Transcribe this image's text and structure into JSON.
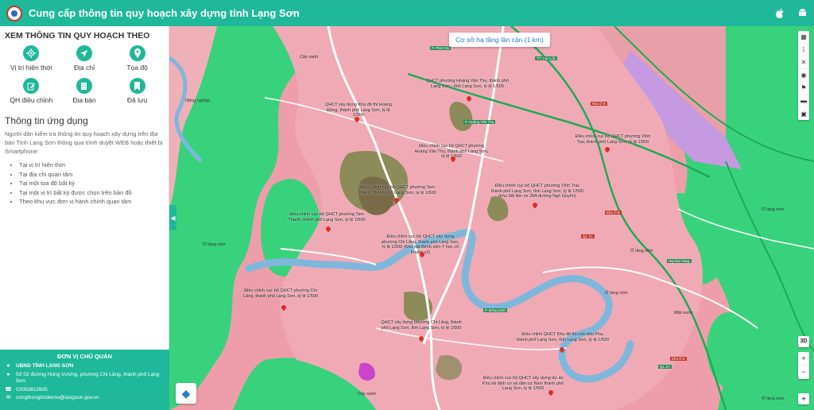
{
  "header": {
    "title": "Cung cấp thông tin quy hoạch xây dựng tỉnh Lạng Sơn",
    "icons": [
      "apple-icon",
      "android-icon"
    ]
  },
  "sidebar": {
    "title": "XEM THÔNG TIN QUY HOẠCH THEO",
    "items": [
      {
        "label": "Vị trí hiện thời",
        "icon": "crosshair-icon"
      },
      {
        "label": "Địa chỉ",
        "icon": "navigation-icon"
      },
      {
        "label": "Tọa độ",
        "icon": "location-pin-icon"
      },
      {
        "label": "QH điều chỉnh",
        "icon": "edit-icon"
      },
      {
        "label": "Địa bàn",
        "icon": "building-icon"
      },
      {
        "label": "Đã lưu",
        "icon": "bookmark-icon"
      }
    ],
    "app_title": "Thông tin ứng dụng",
    "app_desc": "Người dân kiểm tra thông tin quy hoạch xây dựng trên địa bàn Tỉnh Lạng Sơn thông qua trình duyệt WEB hoặc thiết bị Smartphone:",
    "app_list": [
      "Tại vị trí hiện thời",
      "Tại địa chỉ quan tâm",
      "Tại một tọa độ bất kỳ",
      "Tại một vị trí bất kỳ được chọn trên bản đồ",
      "Theo khu vực đơn vị hành chính quan tâm"
    ]
  },
  "footer": {
    "heading": "ĐƠN VỊ CHỦ QUẢN",
    "org": "UBND TỈNH LẠNG SƠN",
    "address": "Số 02 đường Hùng Vương, phường Chi Lăng, thành phố Lạng Sơn",
    "phone": "02053812605",
    "email": "congthongtindientu@langson.gov.vn"
  },
  "map": {
    "search_label": "Cơ sở hạ tầng lân cận (1 km)",
    "zoom_in": "+",
    "zoom_out": "−",
    "mode_3d": "3D",
    "toolbar_icons": [
      "image-icon",
      "share-icon",
      "close-x-icon",
      "camera-icon",
      "flag-icon",
      "ruler-icon",
      "trash-icon"
    ],
    "places": [
      {
        "text": "Cây xanh"
      },
      {
        "text": "Nông nghiệp"
      },
      {
        "text": "Ở làng xóm"
      },
      {
        "text": "Ở làng xóm"
      },
      {
        "text": "Ở làng xóm"
      },
      {
        "text": "Mặt nước"
      },
      {
        "text": "Ở làng xóm"
      },
      {
        "text": "Cây xanh"
      },
      {
        "text": "Ở làng xóm"
      }
    ],
    "plan_labels": [
      {
        "text": "QHCT xây dựng Khu đô thị Hoàng Đồng, thành phố Lạng Sơn, tỷ lệ 1/500"
      },
      {
        "text": "QHCT phường Hoàng Văn Thụ, thành phố Lạng Sơn - tỉnh Lạng Sơn, tỷ lệ 1/500"
      },
      {
        "text": "Điều chỉnh cục bộ QHCT phường Hoàng Văn Thụ, thành phố Lạng Sơn, tỷ lệ 1/500"
      },
      {
        "text": "Điều chỉnh cục bộ QHCT phường Vĩnh Trại, thành phố Lạng Sơn, tỷ lệ 1/500"
      },
      {
        "text": "Điều chỉnh cục bộ QHCT phường Tam Thanh, thành phố Lạng Sơn, tỷ lệ 1/500"
      },
      {
        "text": "Điều chỉnh cục bộ QHCT phường Vĩnh Trại, thành phố Lạng Sơn, tỉnh Lạng Sơn, tỷ lệ 1/500 (khu đất liền xe 28A đường Ngô Quyền)"
      },
      {
        "text": "Điều chỉnh cục bộ QHCT phường Tam Thanh, thành phố Lạng Sơn, tỷ lệ 1/500"
      },
      {
        "text": "Điều chỉnh cục bộ QHCT xây dựng phường Chi Lăng, thành phố Lạng Sơn, tỷ lệ 1/500 (Khu đất Bệnh viện Y học cổ truyền cũ)"
      },
      {
        "text": "Điều chỉnh cục bộ QHCT phường Chi Lăng, thành phố Lạng Sơn, tỷ lệ 1/500"
      },
      {
        "text": "QHCT xây dựng phường Chi Lăng, thành phố Lạng Sơn, tỉnh Lạng Sơn, tỷ lệ 1/500"
      },
      {
        "text": "Điều chỉnh QHCT Khu đô thị mới Mai Pha, thành phố Lạng Sơn, tỉnh Lạng Sơn, tỷ lệ 1/500"
      },
      {
        "text": "Điều chỉnh cục bộ QHCT xây dựng dự án Khu tái định cư và dân cư Nam thành phố Lạng Sơn, tỷ lệ 1/500"
      }
    ],
    "road_tags": [
      {
        "text": "P. Phai Cải"
      },
      {
        "text": "TT. Cao Lộc"
      },
      {
        "text": "P. Hoàng Văn Thụ"
      },
      {
        "text": "Khu Ô 8"
      },
      {
        "text": "Khu Ô 9"
      },
      {
        "text": "QL 1A"
      },
      {
        "text": "P. Đông Kinh"
      },
      {
        "text": "QL 1A"
      },
      {
        "text": "Khu Ô 8"
      },
      {
        "text": "HQ Nai Vàng"
      }
    ]
  },
  "colors": {
    "brand": "#1fb89a",
    "pin": "#d93025",
    "river": "#7fb7dc",
    "green_zone": "#39d27c"
  }
}
